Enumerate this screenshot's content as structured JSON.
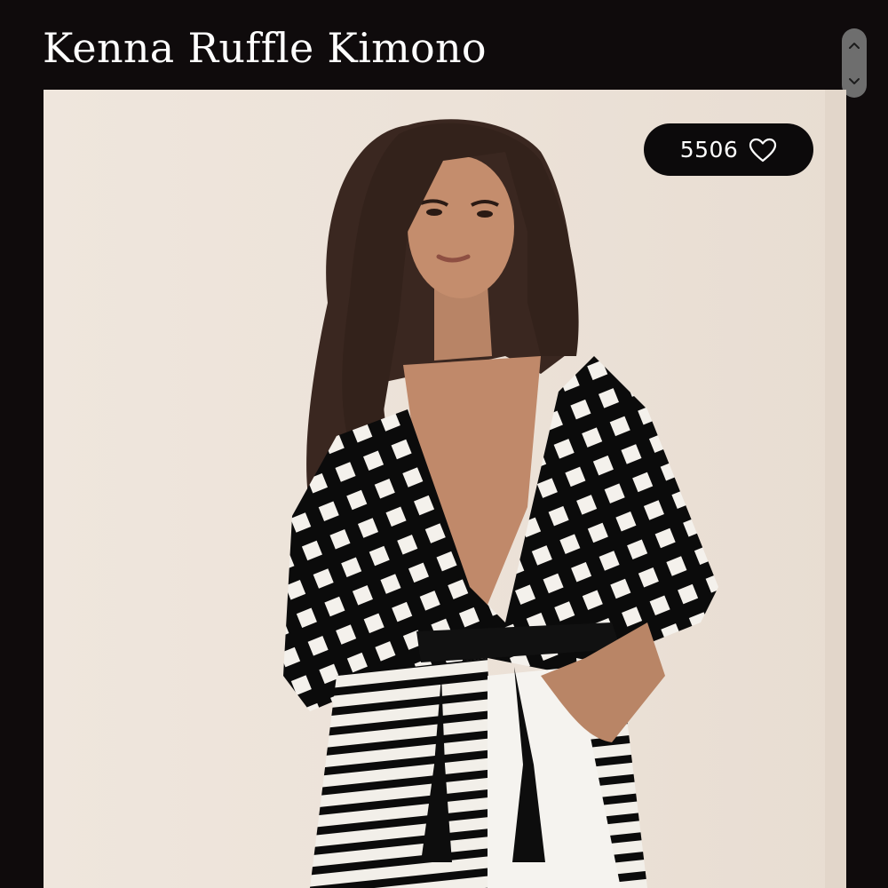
{
  "product": {
    "title": "Kenna Ruffle Kimono",
    "photo_icon": "model-photo"
  },
  "likes": {
    "count": "5506",
    "icon": "heart-outline-icon"
  },
  "scroll": {
    "up_icon": "chevron-up-icon",
    "down_icon": "chevron-down-icon"
  },
  "colors": {
    "background": "#0f0b0c",
    "photo_backdrop": "#ece2d8",
    "pill": "#0c0a0b",
    "scroll_track": "#6e6e6e"
  }
}
